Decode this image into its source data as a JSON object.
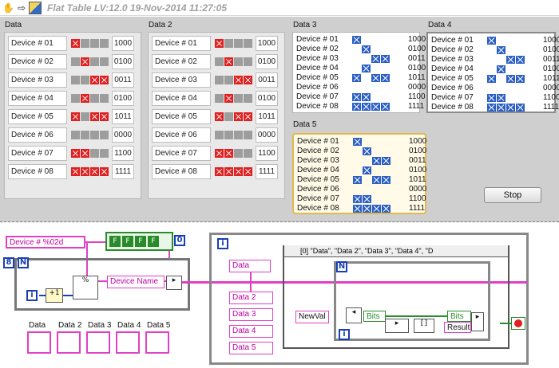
{
  "window": {
    "title": "Flat Table LV:12.0 19-Nov-2014 11:27:05"
  },
  "clusters": [
    {
      "label": "Data",
      "rows": [
        {
          "name": "Device # 01",
          "bits": [
            1,
            0,
            0,
            0
          ],
          "value": "1000"
        },
        {
          "name": "Device # 02",
          "bits": [
            0,
            1,
            0,
            0
          ],
          "value": "0100"
        },
        {
          "name": "Device # 03",
          "bits": [
            0,
            0,
            1,
            1
          ],
          "value": "0011"
        },
        {
          "name": "Device # 04",
          "bits": [
            0,
            1,
            0,
            0
          ],
          "value": "0100"
        },
        {
          "name": "Device # 05",
          "bits": [
            1,
            0,
            1,
            1
          ],
          "value": "1011"
        },
        {
          "name": "Device # 06",
          "bits": [
            0,
            0,
            0,
            0
          ],
          "value": "0000"
        },
        {
          "name": "Device # 07",
          "bits": [
            1,
            1,
            0,
            0
          ],
          "value": "1100"
        },
        {
          "name": "Device # 08",
          "bits": [
            1,
            1,
            1,
            1
          ],
          "value": "1111"
        }
      ]
    },
    {
      "label": "Data 2",
      "rows": [
        {
          "name": "Device # 01",
          "bits": [
            1,
            0,
            0,
            0
          ],
          "value": "1000"
        },
        {
          "name": "Device # 02",
          "bits": [
            0,
            1,
            0,
            0
          ],
          "value": "0100"
        },
        {
          "name": "Device # 03",
          "bits": [
            0,
            0,
            1,
            1
          ],
          "value": "0011"
        },
        {
          "name": "Device # 04",
          "bits": [
            0,
            1,
            0,
            0
          ],
          "value": "0100"
        },
        {
          "name": "Device # 05",
          "bits": [
            1,
            0,
            1,
            1
          ],
          "value": "1011"
        },
        {
          "name": "Device # 06",
          "bits": [
            0,
            0,
            0,
            0
          ],
          "value": "0000"
        },
        {
          "name": "Device # 07",
          "bits": [
            1,
            1,
            0,
            0
          ],
          "value": "1100"
        },
        {
          "name": "Device # 08",
          "bits": [
            1,
            1,
            1,
            1
          ],
          "value": "1111"
        }
      ]
    }
  ],
  "tables": [
    {
      "label": "Data 3",
      "rows": [
        {
          "name": "Device # 01",
          "bits": [
            1,
            0,
            0,
            0
          ],
          "value": "1000"
        },
        {
          "name": "Device # 02",
          "bits": [
            0,
            1,
            0,
            0
          ],
          "value": "0100"
        },
        {
          "name": "Device # 03",
          "bits": [
            0,
            0,
            1,
            1
          ],
          "value": "0011"
        },
        {
          "name": "Device # 04",
          "bits": [
            0,
            1,
            0,
            0
          ],
          "value": "0100"
        },
        {
          "name": "Device # 05",
          "bits": [
            1,
            0,
            1,
            1
          ],
          "value": "1011"
        },
        {
          "name": "Device # 06",
          "bits": [
            0,
            0,
            0,
            0
          ],
          "value": "0000"
        },
        {
          "name": "Device # 07",
          "bits": [
            1,
            1,
            0,
            0
          ],
          "value": "1100"
        },
        {
          "name": "Device # 08",
          "bits": [
            1,
            1,
            1,
            1
          ],
          "value": "1111"
        }
      ]
    },
    {
      "label": "Data 4",
      "rows": [
        {
          "name": "Device # 01",
          "bits": [
            1,
            0,
            0,
            0
          ],
          "value": "1000"
        },
        {
          "name": "Device # 02",
          "bits": [
            0,
            1,
            0,
            0
          ],
          "value": "0100"
        },
        {
          "name": "Device # 03",
          "bits": [
            0,
            0,
            1,
            1
          ],
          "value": "0011"
        },
        {
          "name": "Device # 04",
          "bits": [
            0,
            1,
            0,
            0
          ],
          "value": "0100"
        },
        {
          "name": "Device # 05",
          "bits": [
            1,
            0,
            1,
            1
          ],
          "value": "1011"
        },
        {
          "name": "Device # 06",
          "bits": [
            0,
            0,
            0,
            0
          ],
          "value": "0000"
        },
        {
          "name": "Device # 07",
          "bits": [
            1,
            1,
            0,
            0
          ],
          "value": "1100"
        },
        {
          "name": "Device # 08",
          "bits": [
            1,
            1,
            1,
            1
          ],
          "value": "1111"
        }
      ]
    },
    {
      "label": "Data 5",
      "rows": [
        {
          "name": "Device # 01",
          "bits": [
            1,
            0,
            0,
            0
          ],
          "value": "1000"
        },
        {
          "name": "Device # 02",
          "bits": [
            0,
            1,
            0,
            0
          ],
          "value": "0100"
        },
        {
          "name": "Device # 03",
          "bits": [
            0,
            0,
            1,
            1
          ],
          "value": "0011"
        },
        {
          "name": "Device # 04",
          "bits": [
            0,
            1,
            0,
            0
          ],
          "value": "0100"
        },
        {
          "name": "Device # 05",
          "bits": [
            1,
            0,
            1,
            1
          ],
          "value": "1011"
        },
        {
          "name": "Device # 06",
          "bits": [
            0,
            0,
            0,
            0
          ],
          "value": "0000"
        },
        {
          "name": "Device # 07",
          "bits": [
            1,
            1,
            0,
            0
          ],
          "value": "1100"
        },
        {
          "name": "Device # 08",
          "bits": [
            1,
            1,
            1,
            1
          ],
          "value": "1111"
        }
      ]
    }
  ],
  "stop_button": {
    "label": "Stop"
  },
  "diagram": {
    "format_string": "Device # %02d",
    "loop_count_label": "N",
    "loop_count_value": "8",
    "iteration_label": "i",
    "device_name_label": "Device Name",
    "bool_constants": [
      "F",
      "F",
      "F",
      "F"
    ],
    "array_index": "0",
    "case_selector": "[0] \"Data\", \"Data 2\", \"Data 3\", \"Data 4\", \"D",
    "ref_labels": [
      "Data",
      "Data 2",
      "Data 3",
      "Data 4",
      "Data 5"
    ],
    "newval_label": "NewVal",
    "bits_label": "Bits",
    "bits_label_2": "Bits",
    "result_label": "Result",
    "indicator_labels": [
      "Data",
      "Data 2",
      "Data 3",
      "Data 4",
      "Data 5"
    ],
    "colors": {
      "string_wire": "#e040c8",
      "bool_wire": "#2a8b2a",
      "numeric": "#1a3fb5"
    }
  }
}
